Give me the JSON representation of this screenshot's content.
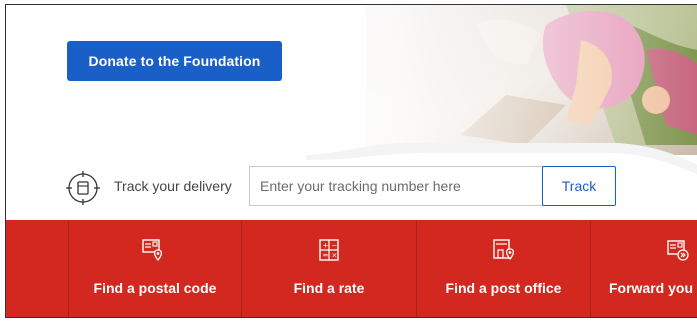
{
  "donate_label": "Donate to the Foundation",
  "track": {
    "label": "Track your delivery",
    "placeholder": "Enter your tracking number here",
    "button": "Track"
  },
  "quick_links": [
    {
      "label": "Find a postal code",
      "icon": "postal-code-icon"
    },
    {
      "label": "Find a rate",
      "icon": "calculator-icon"
    },
    {
      "label": "Find a post office",
      "icon": "post-office-icon"
    },
    {
      "label": "Forward you",
      "icon": "forward-mail-icon"
    }
  ],
  "colors": {
    "brand_red": "#d3281f",
    "primary_blue": "#1a5fc8"
  }
}
